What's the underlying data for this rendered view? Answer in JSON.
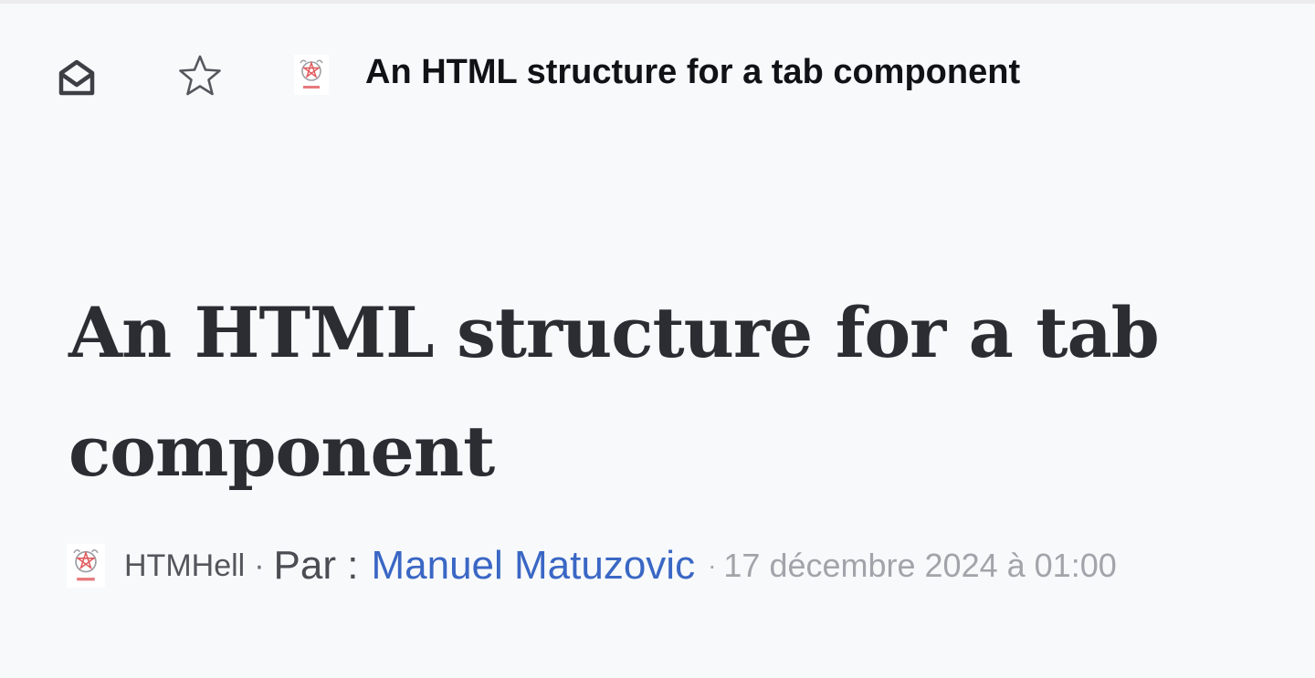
{
  "header": {
    "title": "An HTML structure for a tab component",
    "mark_read_icon": "envelope-open-icon",
    "favorite_icon": "star-outline-icon",
    "feed_icon": "htmhell-favicon"
  },
  "article": {
    "title": "An HTML structure for a tab component",
    "source": "HTMHell",
    "separator": "·",
    "by_label": "Par :",
    "author": "Manuel Matuzovic",
    "date": "17 décembre 2024 à 01:00"
  },
  "colors": {
    "background": "#f8f9fb",
    "title_text": "#2b2d33",
    "author_link": "#3a67c5",
    "muted_text": "#a2a4aa",
    "favicon_red": "#e0585a"
  }
}
